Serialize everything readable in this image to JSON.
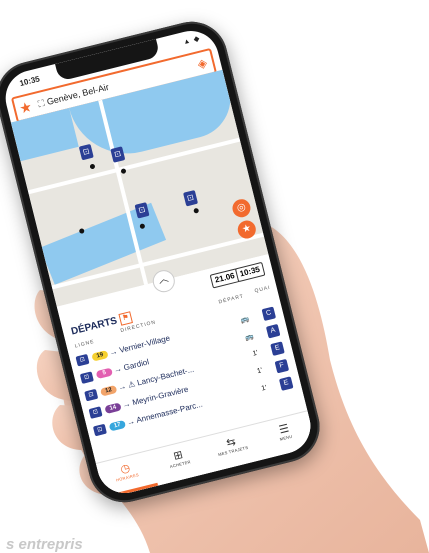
{
  "statusbar": {
    "time": "10:35",
    "signal": "▲ ◆"
  },
  "search": {
    "location": "Genève, Bel-Air"
  },
  "map": {
    "water_color": "#8fc9ef",
    "stop_color": "#2b3f95"
  },
  "times": {
    "time1": "21.06",
    "time2": "10:35"
  },
  "departures": {
    "title": "DÉPARTS",
    "col_line": "LIGNE",
    "col_direction": "DIRECTION",
    "col_depart": "DÉPART",
    "col_quai": "QUAI",
    "rows": [
      {
        "line": "19",
        "color": "#f6d02f",
        "text_color": "#222",
        "destination": "→ Vernier-Village",
        "quai": "C"
      },
      {
        "line": "5",
        "color": "#e25fb1",
        "text_color": "#fff",
        "destination": "→ Gardiol",
        "quai": "A"
      },
      {
        "line": "12",
        "color": "#f2a46a",
        "text_color": "#222",
        "destination": "→ ⚠ Lancy-Bachet-...",
        "quai": "E"
      },
      {
        "line": "14",
        "color": "#7a3f97",
        "text_color": "#fff",
        "destination": "→ Meyrin-Gravière",
        "quai": "F"
      },
      {
        "line": "17",
        "color": "#36a6dd",
        "text_color": "#fff",
        "destination": "→ Annemasse-Parc...",
        "quai": "E"
      }
    ]
  },
  "tabs": [
    {
      "icon": "clock-icon",
      "glyph": "◷",
      "label": "HORAIRES",
      "active": true
    },
    {
      "icon": "ticket-icon",
      "glyph": "⊞",
      "label": "ACHETER",
      "active": false
    },
    {
      "icon": "route-icon",
      "glyph": "⇆",
      "label": "MES TRAJETS",
      "active": false
    },
    {
      "icon": "menu-icon",
      "glyph": "☰",
      "label": "MENU",
      "active": false
    }
  ],
  "caption": "s entrepris"
}
